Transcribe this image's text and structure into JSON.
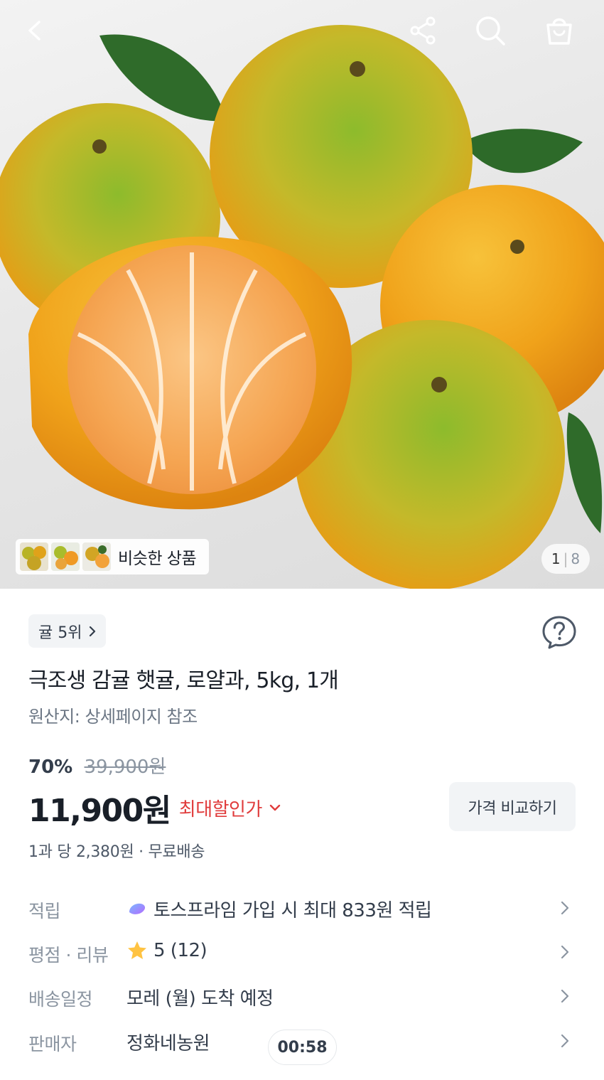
{
  "hero": {
    "similar_label": "비슷한 상품",
    "pager": {
      "current": "1",
      "separator": "|",
      "total": "8"
    }
  },
  "product": {
    "rank_badge": "귤 5위",
    "title": "극조생 감귤 햇귤, 로얄과, 5kg, 1개",
    "origin": "원산지: 상세페이지 참조",
    "discount_percent": "70%",
    "original_price": "39,900원",
    "price": "11,900원",
    "max_discount_label": "최대할인가",
    "compare_button": "가격 비교하기",
    "unit_price": "1과 당 2,380원 · 무료배송"
  },
  "info_rows": [
    {
      "label": "적립",
      "value": "토스프라임 가입 시 최대 833원 적립",
      "icon": "toss-prime-icon"
    },
    {
      "label": "평점 · 리뷰",
      "value": "5 (12)",
      "icon": "star-icon"
    },
    {
      "label": "배송일정",
      "value": "모레 (월) 도착 예정",
      "icon": ""
    },
    {
      "label": "판매자",
      "value": "정화네농원",
      "icon": ""
    }
  ],
  "timer": "00:58",
  "icons": [
    "back-icon",
    "share-icon",
    "search-icon",
    "cart-icon",
    "help-icon",
    "chevron-right-icon",
    "chevron-down-icon"
  ],
  "colors": {
    "sale_red": "#e03c3c",
    "gray_text": "#8b95a1",
    "star": "#ffc342",
    "chip_bg": "#f2f4f6"
  }
}
